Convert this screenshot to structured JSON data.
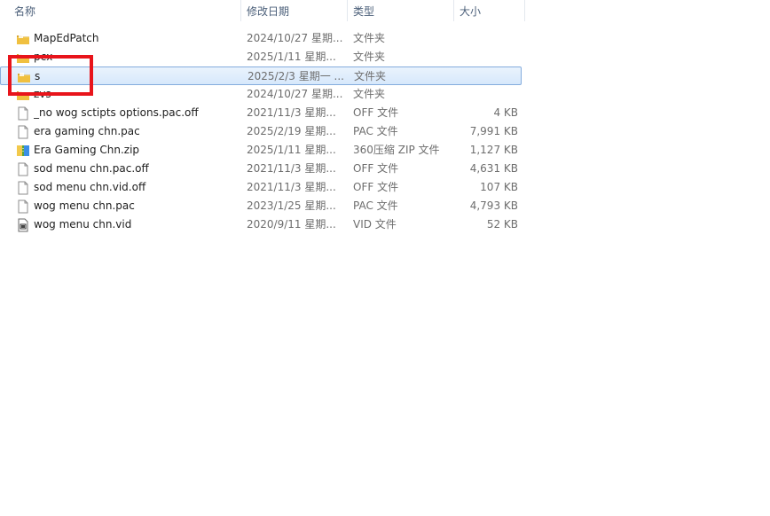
{
  "columns": {
    "name": "名称",
    "date": "修改日期",
    "type": "类型",
    "size": "大小"
  },
  "sort_indicator": "^",
  "files": [
    {
      "name": "MapEdPatch",
      "date": "2024/10/27 星期...",
      "type": "文件夹",
      "size": "",
      "icon": "folder-icon"
    },
    {
      "name": "pcx",
      "date": "2025/1/11 星期...",
      "type": "文件夹",
      "size": "",
      "icon": "folder-icon"
    },
    {
      "name": "s",
      "date": "2025/2/3 星期一 ...",
      "type": "文件夹",
      "size": "",
      "icon": "folder-icon",
      "selected": true
    },
    {
      "name": "zvs",
      "date": "2024/10/27 星期...",
      "type": "文件夹",
      "size": "",
      "icon": "folder-icon"
    },
    {
      "name": "_no wog sctipts options.pac.off",
      "date": "2021/11/3 星期...",
      "type": "OFF 文件",
      "size": "4 KB",
      "icon": "file-icon"
    },
    {
      "name": "era gaming chn.pac",
      "date": "2025/2/19 星期...",
      "type": "PAC 文件",
      "size": "7,991 KB",
      "icon": "file-icon"
    },
    {
      "name": "Era Gaming Chn.zip",
      "date": "2025/1/11 星期...",
      "type": "360压缩 ZIP 文件",
      "size": "1,127 KB",
      "icon": "zip-archive-icon"
    },
    {
      "name": "sod menu chn.pac.off",
      "date": "2021/11/3 星期...",
      "type": "OFF 文件",
      "size": "4,631 KB",
      "icon": "file-icon"
    },
    {
      "name": "sod menu chn.vid.off",
      "date": "2021/11/3 星期...",
      "type": "OFF 文件",
      "size": "107 KB",
      "icon": "file-icon"
    },
    {
      "name": "wog menu chn.pac",
      "date": "2023/1/25 星期...",
      "type": "PAC 文件",
      "size": "4,793 KB",
      "icon": "file-icon"
    },
    {
      "name": "wog menu chn.vid",
      "date": "2020/9/11 星期...",
      "type": "VID 文件",
      "size": "52 KB",
      "icon": "video-file-icon"
    }
  ],
  "colors": {
    "header_text": "#4c607a",
    "selection_border": "#84acdd",
    "highlight_annotation": "#e8141b",
    "folder": "#e8b83a"
  }
}
